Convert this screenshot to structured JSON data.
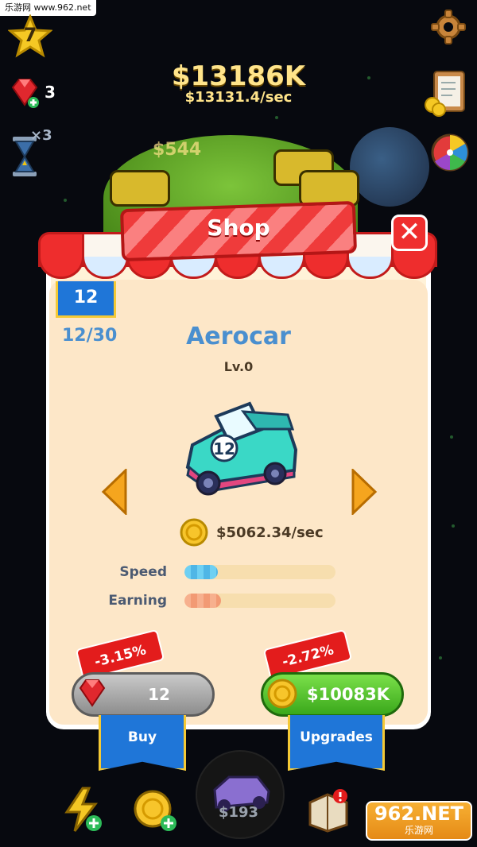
{
  "watermark": {
    "top_text": "乐游网 www.962.net",
    "bottom_brand": "962.NET",
    "bottom_sub": "乐游网"
  },
  "hud": {
    "level": "7",
    "money": "$13186K",
    "rate": "$13131.4/sec",
    "gems": "3",
    "boost_multiplier": "×3",
    "background_floating_money": "$544"
  },
  "shop": {
    "title": "Shop",
    "close_label": "✕",
    "car_tier": "12",
    "progress": "12/30",
    "car_name": "Aerocar",
    "car_level": "Lv.0",
    "car_badge": "12",
    "income": "$5062.34/sec",
    "stats": [
      {
        "label": "Speed",
        "fraction": 0.22
      },
      {
        "label": "Earning",
        "fraction": 0.24
      }
    ],
    "buy_discount": "-3.15%",
    "buy_gem_price": "12",
    "buy_label": "Buy",
    "upgrade_discount": "-2.72%",
    "upgrade_price": "$10083K",
    "upgrade_label": "Upgrades"
  },
  "bottom": {
    "center_price": "$193"
  },
  "colors": {
    "title_blue": "#4a8fcf",
    "money_gold": "#ffe48a",
    "shop_red": "#ee2d2d",
    "buy_green": "#3aa81b"
  }
}
